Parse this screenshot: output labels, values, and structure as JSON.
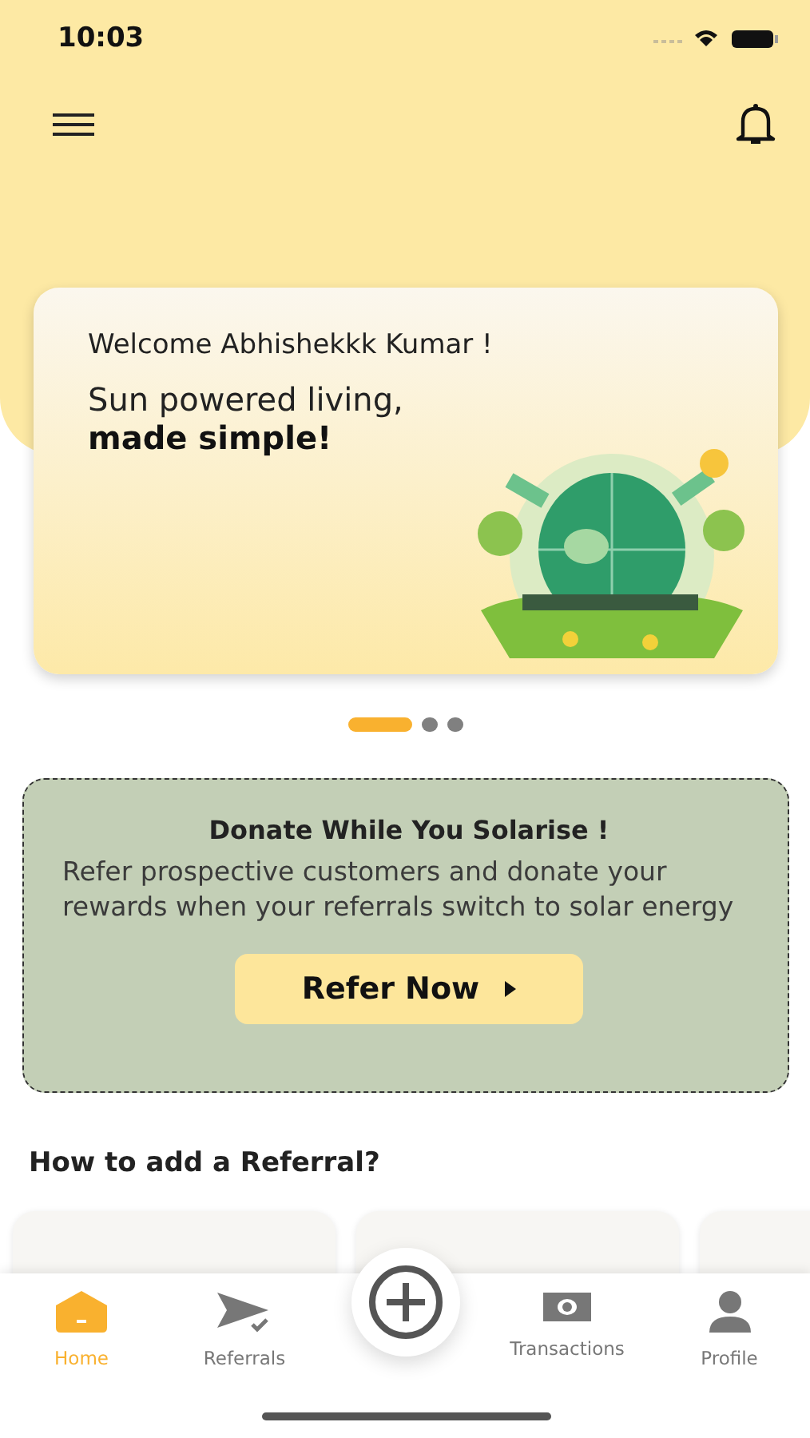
{
  "status_bar": {
    "time": "10:03"
  },
  "hero": {
    "greeting": "Welcome Abhishekkk Kumar !",
    "tagline": "Sun powered living,",
    "tagline_bold": "made simple!"
  },
  "carousel_dots": [
    {
      "selected": true
    },
    {
      "selected": false
    },
    {
      "selected": false
    }
  ],
  "donate_card": {
    "title": "Donate While You Solarise !",
    "body": "Refer prospective customers and donate your rewards when your referrals switch to solar energy",
    "button": "Refer Now"
  },
  "section_title": "How to add a Referral?",
  "step_cards": [
    {
      "kind": "card"
    },
    {
      "kind": "card"
    },
    {
      "kind": "card"
    }
  ],
  "tab_bar": [
    {
      "kind": "home",
      "label": "Home",
      "selected": true
    },
    {
      "kind": "referrals",
      "label": "Referrals",
      "selected": false
    },
    {
      "kind": "add",
      "selected": false
    },
    {
      "kind": "transactions",
      "label": "Transactions",
      "selected": false
    },
    {
      "kind": "profile",
      "label": "Profile",
      "selected": false
    }
  ]
}
